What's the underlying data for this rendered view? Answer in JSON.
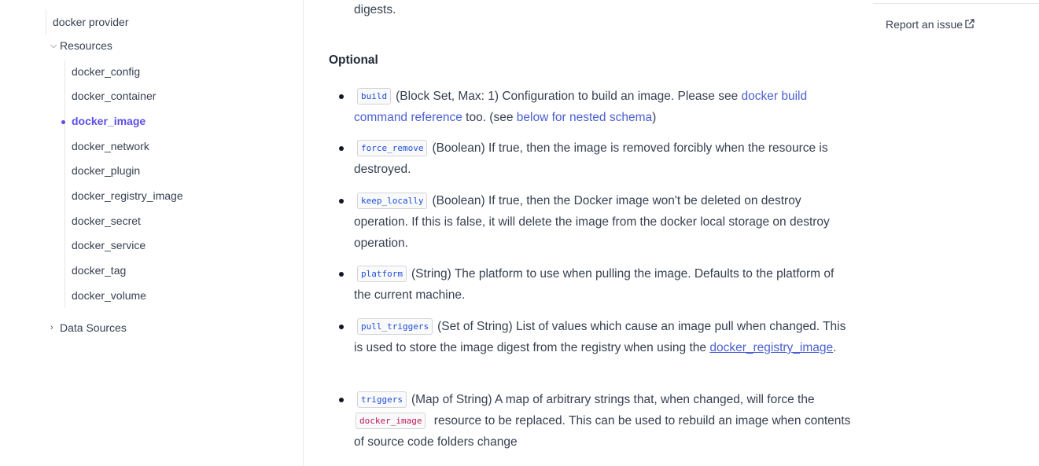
{
  "sidebar": {
    "root": "docker provider",
    "resources_label": "Resources",
    "resources": [
      "docker_config",
      "docker_container",
      "docker_image",
      "docker_network",
      "docker_plugin",
      "docker_registry_image",
      "docker_secret",
      "docker_service",
      "docker_tag",
      "docker_volume"
    ],
    "active": "docker_image",
    "data_sources_label": "Data Sources"
  },
  "content": {
    "intro_tail": "digests.",
    "heading": "Optional",
    "items": [
      {
        "code": "build",
        "pre": "(Block Set, Max: 1) Configuration to build an image. Please see ",
        "link1": "docker build command reference",
        "mid": " too. (see ",
        "link2": "below for nested schema",
        "post": ")"
      },
      {
        "code": "force_remove",
        "text": "(Boolean) If true, then the image is removed forcibly when the resource is destroyed."
      },
      {
        "code": "keep_locally",
        "text": "(Boolean) If true, then the Docker image won't be deleted on destroy operation. If this is false, it will delete the image from the docker local storage on destroy operation."
      },
      {
        "code": "platform",
        "text": "(String) The platform to use when pulling the image. Defaults to the platform of the current machine."
      },
      {
        "code": "pull_triggers",
        "pre": "(Set of String) List of values which cause an image pull when changed. This is used to store the image digest from the registry when using the ",
        "link1": "docker_registry_image",
        "post": "."
      },
      {
        "code": "triggers",
        "pre": "(Map of String) A map of arbitrary strings that, when changed, will force the ",
        "code2": "docker_image",
        "post": " resource to be replaced. This can be used to rebuild an image when contents of source code folders change"
      }
    ]
  },
  "right": {
    "report_label": "Report an issue"
  },
  "colors": {
    "accent": "#5c4ee5",
    "link": "#4a5fd0",
    "code_text": "#1d4ed8",
    "code_pink": "#be185d"
  }
}
